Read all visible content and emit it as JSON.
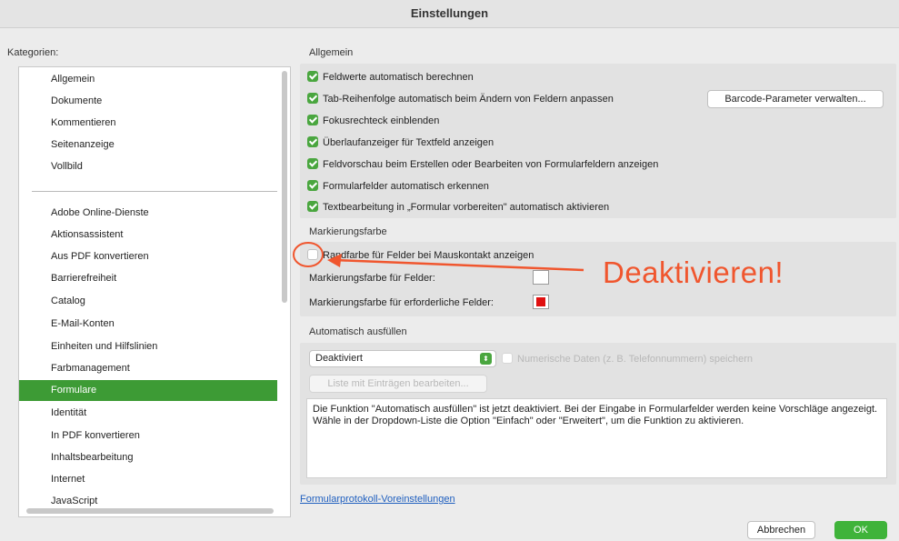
{
  "window": {
    "title": "Einstellungen"
  },
  "categories": {
    "label": "Kategorien:",
    "group1": [
      "Allgemein",
      "Dokumente",
      "Kommentieren",
      "Seitenanzeige",
      "Vollbild"
    ],
    "group2": [
      "Adobe Online-Dienste",
      "Aktionsassistent",
      "Aus PDF konvertieren",
      "Barrierefreiheit",
      "Catalog",
      "E-Mail-Konten",
      "Einheiten und Hilfslinien",
      "Farbmanagement",
      "Formulare",
      "Identität",
      "In PDF konvertieren",
      "Inhaltsbearbeitung",
      "Internet",
      "JavaScript"
    ],
    "selected": "Formulare"
  },
  "general": {
    "title": "Allgemein",
    "options": [
      {
        "label": "Feldwerte automatisch berechnen",
        "checked": true
      },
      {
        "label": "Tab-Reihenfolge automatisch beim Ändern von Feldern anpassen",
        "checked": true
      },
      {
        "label": "Fokusrechteck einblenden",
        "checked": true
      },
      {
        "label": "Überlaufanzeiger für Textfeld anzeigen",
        "checked": true
      },
      {
        "label": "Feldvorschau beim Erstellen oder Bearbeiten von Formularfeldern anzeigen",
        "checked": true
      },
      {
        "label": "Formularfelder automatisch erkennen",
        "checked": true
      },
      {
        "label": "Textbearbeitung in „Formular vorbereiten\" automatisch aktivieren",
        "checked": true
      }
    ],
    "barcode_button": "Barcode-Parameter verwalten..."
  },
  "highlight": {
    "title": "Markierungsfarbe",
    "border_option": {
      "label": "Randfarbe für Felder bei Mauskontakt anzeigen",
      "checked": false
    },
    "field_color_label": "Markierungsfarbe für Felder:",
    "field_color": "#ffffff",
    "required_color_label": "Markierungsfarbe für erforderliche Felder:",
    "required_color": "#e01010"
  },
  "autofill": {
    "title": "Automatisch ausfüllen",
    "mode": "Deaktiviert",
    "numeric_option": {
      "label": "Numerische Daten (z. B. Telefonnummern) speichern",
      "checked": false,
      "enabled": false
    },
    "edit_list_button": "Liste mit Einträgen bearbeiten...",
    "description": "Die Funktion \"Automatisch ausfüllen\" ist jetzt deaktiviert. Bei der Eingabe in Formularfelder werden keine Vorschläge angezeigt. Wähle in der Dropdown-Liste die Option \"Einfach\" oder \"Erweitert\", um die Funktion zu aktivieren."
  },
  "footer": {
    "link": "Formularprotokoll-Voreinstellungen",
    "cancel": "Abbrechen",
    "ok": "OK"
  },
  "annotation": {
    "text": "Deaktivieren!",
    "color": "#f0562e"
  },
  "colors": {
    "accent": "#3d9b35",
    "checkbox": "#4aa63f",
    "link": "#1f5fbf"
  }
}
